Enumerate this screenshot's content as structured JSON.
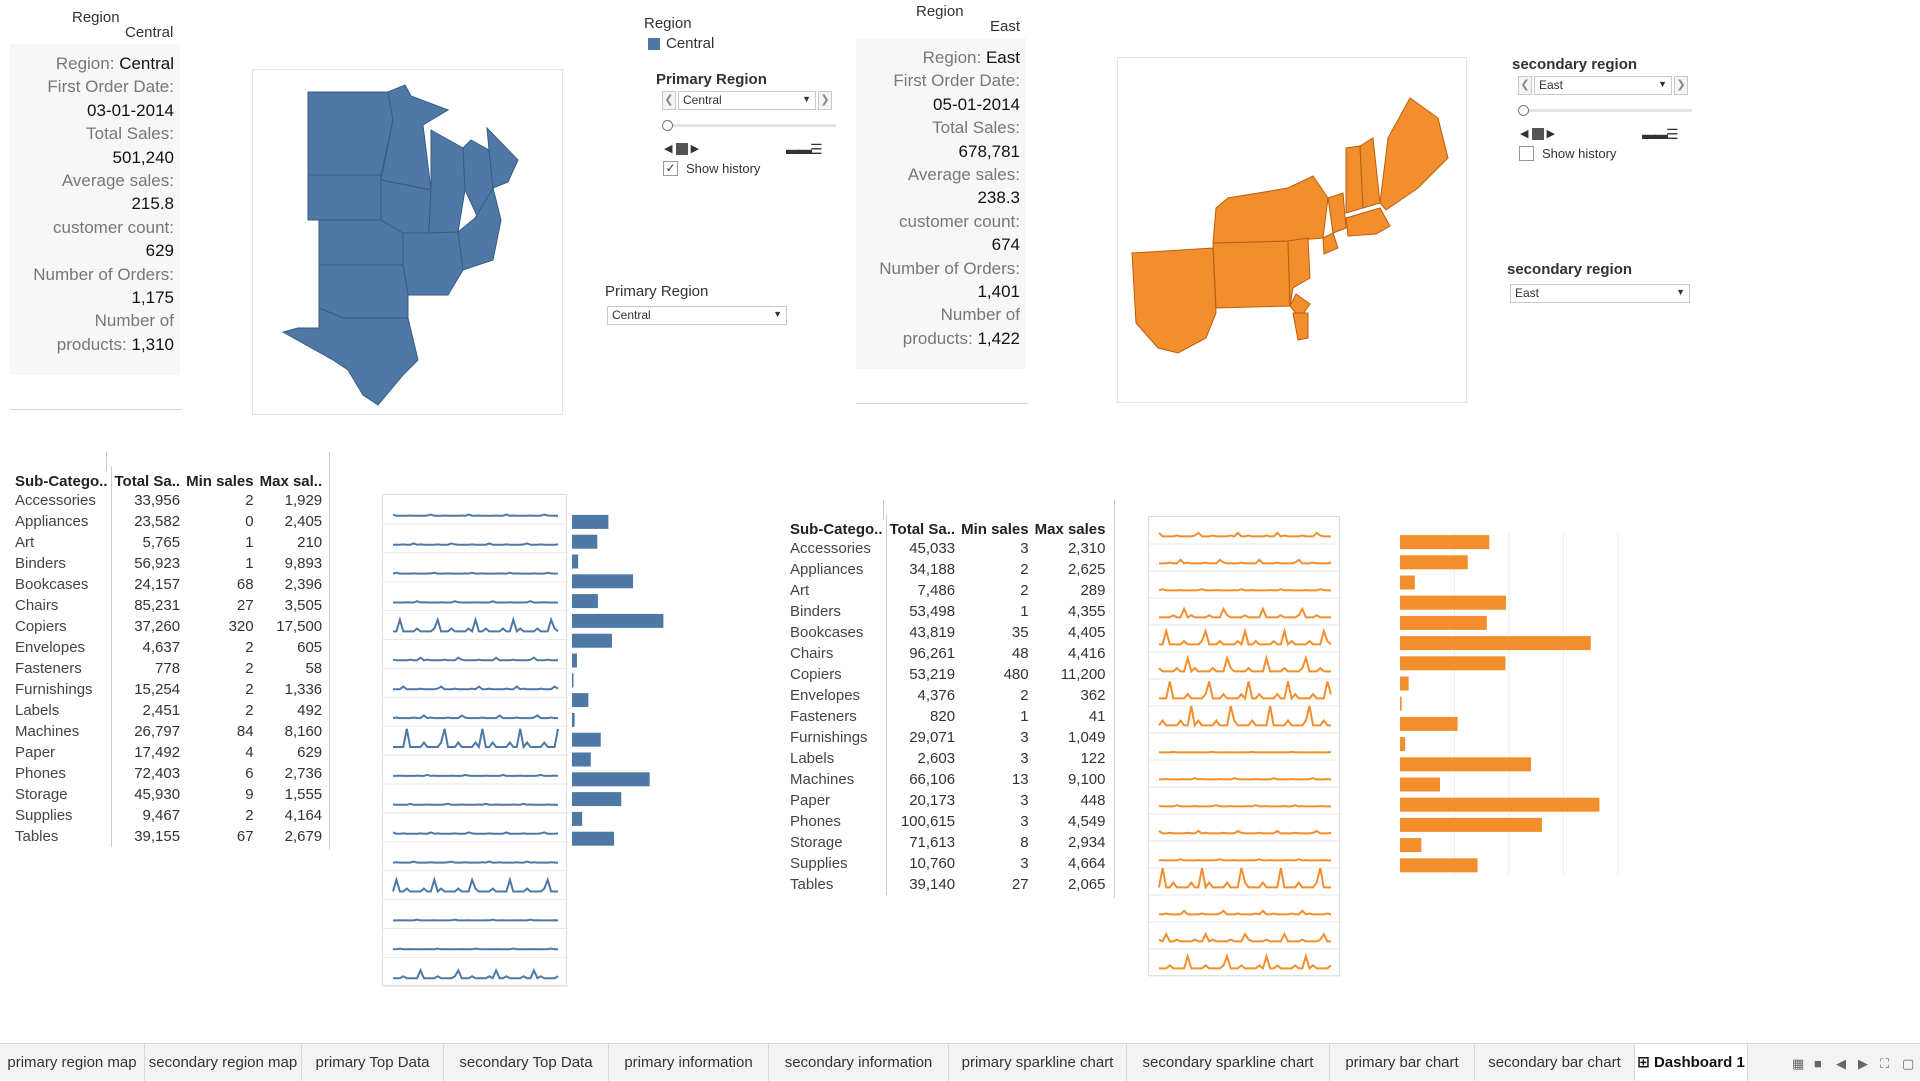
{
  "colors": {
    "primary": "#4e79a7",
    "secondary": "#f28e2b"
  },
  "primary_card": {
    "header_label": "Region",
    "header_value": "Central",
    "region_label": "Region:",
    "region_value": "Central",
    "first_order_label": "First Order Date:",
    "first_order_value": "03-01-2014",
    "total_sales_label": "Total Sales:",
    "total_sales_value": "501,240",
    "avg_sales_label": "Average sales:",
    "avg_sales_value": "215.8",
    "customer_count_label": "customer count:",
    "customer_count_value": "629",
    "orders_label": "Number of Orders:",
    "orders_value": "1,175",
    "products_label_1": "Number of",
    "products_label_2": "products:",
    "products_value": "1,310"
  },
  "secondary_card": {
    "header_label": "Region",
    "header_value": "East",
    "region_label": "Region:",
    "region_value": "East",
    "first_order_label": "First Order Date:",
    "first_order_value": "05-01-2014",
    "total_sales_label": "Total Sales:",
    "total_sales_value": "678,781",
    "avg_sales_label": "Average sales:",
    "avg_sales_value": "238.3",
    "customer_count_label": "customer count:",
    "customer_count_value": "674",
    "orders_label": "Number of Orders:",
    "orders_value": "1,401",
    "products_label_1": "Number of",
    "products_label_2": "products:",
    "products_value": "1,422"
  },
  "legend": {
    "title": "Region",
    "item": "Central"
  },
  "primary_filter": {
    "title": "Primary Region",
    "selected": "Central",
    "show_history": "Show history",
    "show_history_checked": true,
    "dropdown_title": "Primary Region",
    "dropdown_value": "Central"
  },
  "secondary_filter": {
    "title": "secondary region",
    "selected": "East",
    "show_history": "Show history",
    "show_history_checked": false,
    "dropdown_title": "secondary region",
    "dropdown_value": "East"
  },
  "table_headers": {
    "cat": "Sub-Catego..",
    "total_primary": "Total Sa..",
    "total_secondary": "Total Sa..",
    "min": "Min sales",
    "max_primary": "Max sal..",
    "max_secondary": "Max sales"
  },
  "primary_table": [
    [
      "Accessories",
      "33,956",
      "2",
      "1,929"
    ],
    [
      "Appliances",
      "23,582",
      "0",
      "2,405"
    ],
    [
      "Art",
      "5,765",
      "1",
      "210"
    ],
    [
      "Binders",
      "56,923",
      "1",
      "9,893"
    ],
    [
      "Bookcases",
      "24,157",
      "68",
      "2,396"
    ],
    [
      "Chairs",
      "85,231",
      "27",
      "3,505"
    ],
    [
      "Copiers",
      "37,260",
      "320",
      "17,500"
    ],
    [
      "Envelopes",
      "4,637",
      "2",
      "605"
    ],
    [
      "Fasteners",
      "778",
      "2",
      "58"
    ],
    [
      "Furnishings",
      "15,254",
      "2",
      "1,336"
    ],
    [
      "Labels",
      "2,451",
      "2",
      "492"
    ],
    [
      "Machines",
      "26,797",
      "84",
      "8,160"
    ],
    [
      "Paper",
      "17,492",
      "4",
      "629"
    ],
    [
      "Phones",
      "72,403",
      "6",
      "2,736"
    ],
    [
      "Storage",
      "45,930",
      "9",
      "1,555"
    ],
    [
      "Supplies",
      "9,467",
      "2",
      "4,164"
    ],
    [
      "Tables",
      "39,155",
      "67",
      "2,679"
    ]
  ],
  "secondary_table": [
    [
      "Accessories",
      "45,033",
      "3",
      "2,310"
    ],
    [
      "Appliances",
      "34,188",
      "2",
      "2,625"
    ],
    [
      "Art",
      "7,486",
      "2",
      "289"
    ],
    [
      "Binders",
      "53,498",
      "1",
      "4,355"
    ],
    [
      "Bookcases",
      "43,819",
      "35",
      "4,405"
    ],
    [
      "Chairs",
      "96,261",
      "48",
      "4,416"
    ],
    [
      "Copiers",
      "53,219",
      "480",
      "11,200"
    ],
    [
      "Envelopes",
      "4,376",
      "2",
      "362"
    ],
    [
      "Fasteners",
      "820",
      "1",
      "41"
    ],
    [
      "Furnishings",
      "29,071",
      "3",
      "1,049"
    ],
    [
      "Labels",
      "2,603",
      "3",
      "122"
    ],
    [
      "Machines",
      "66,106",
      "13",
      "9,100"
    ],
    [
      "Paper",
      "20,173",
      "3",
      "448"
    ],
    [
      "Phones",
      "100,615",
      "3",
      "4,549"
    ],
    [
      "Storage",
      "71,613",
      "8",
      "2,934"
    ],
    [
      "Supplies",
      "10,760",
      "3",
      "4,664"
    ],
    [
      "Tables",
      "39,140",
      "27",
      "2,065"
    ]
  ],
  "chart_data": [
    {
      "type": "bar",
      "name": "primary bar chart",
      "categories": [
        "Accessories",
        "Appliances",
        "Art",
        "Binders",
        "Bookcases",
        "Chairs",
        "Copiers",
        "Envelopes",
        "Fasteners",
        "Furnishings",
        "Labels",
        "Machines",
        "Paper",
        "Phones",
        "Storage",
        "Supplies",
        "Tables"
      ],
      "values": [
        33956,
        23582,
        5765,
        56923,
        24157,
        85231,
        37260,
        4637,
        778,
        15254,
        2451,
        26797,
        17492,
        72403,
        45930,
        9467,
        39155
      ],
      "xlim": [
        0,
        110000
      ]
    },
    {
      "type": "bar",
      "name": "secondary bar chart",
      "categories": [
        "Accessories",
        "Appliances",
        "Art",
        "Binders",
        "Bookcases",
        "Chairs",
        "Copiers",
        "Envelopes",
        "Fasteners",
        "Furnishings",
        "Labels",
        "Machines",
        "Paper",
        "Phones",
        "Storage",
        "Supplies",
        "Tables"
      ],
      "values": [
        45033,
        34188,
        7486,
        53498,
        43819,
        96261,
        53219,
        4376,
        820,
        29071,
        2603,
        66106,
        20173,
        100615,
        71613,
        10760,
        39140
      ],
      "xlim": [
        0,
        110000
      ]
    },
    {
      "type": "line",
      "name": "primary sparkline chart",
      "rows": 17,
      "spike_profile": [
        0.05,
        0.05,
        0.03,
        0.05,
        0.45,
        0.1,
        0.1,
        0.1,
        0.7,
        0.04,
        0.04,
        0.05,
        0.04,
        0.45,
        0.03,
        0.03,
        0.3
      ]
    },
    {
      "type": "line",
      "name": "secondary sparkline chart",
      "rows": 17,
      "spike_profile": [
        0.15,
        0.15,
        0.05,
        0.35,
        0.55,
        0.55,
        0.7,
        0.8,
        0.02,
        0.05,
        0.05,
        0.1,
        0.05,
        0.8,
        0.15,
        0.3,
        0.5
      ]
    }
  ],
  "tabs": [
    "primary region map",
    "secondary region map",
    "primary Top Data",
    "secondary Top Data",
    "primary information",
    "secondary information",
    "primary sparkline chart",
    "secondary sparkline chart",
    "primary bar chart",
    "secondary bar chart",
    "Dashboard 1"
  ],
  "active_tab": "Dashboard 1"
}
